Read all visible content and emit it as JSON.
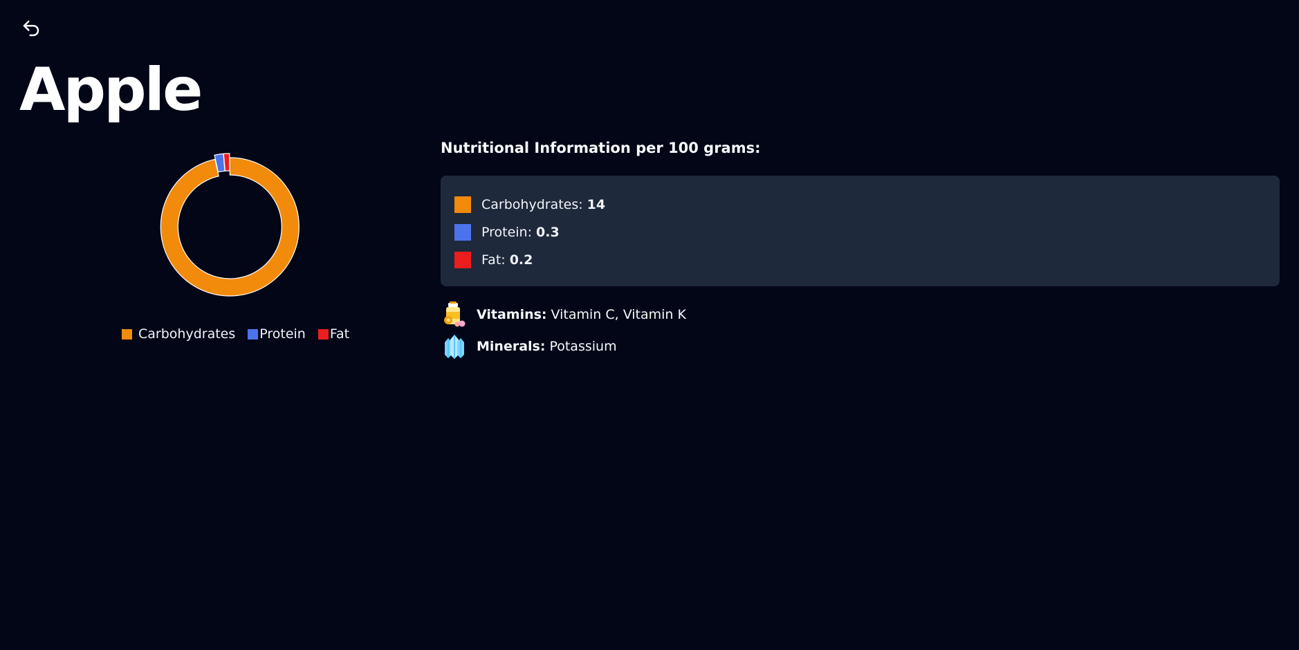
{
  "header": {
    "title": "Apple"
  },
  "icons": {
    "back": "undo-arrow-icon",
    "vitamins": "vitamin-bottle-icon",
    "minerals": "mineral-crystal-icon"
  },
  "colors": {
    "background": "#020617",
    "panel": "#1e293b",
    "carbohydrates": "#f28a0c",
    "protein": "#4b74ec",
    "fat": "#ee1d1d"
  },
  "chart_data": {
    "type": "doughnut",
    "categories": [
      "Carbohydrates",
      "Protein",
      "Fat"
    ],
    "values": [
      14,
      0.3,
      0.2
    ],
    "colors": [
      "#f28a0c",
      "#4b74ec",
      "#ee1d1d"
    ],
    "legend_position": "bottom"
  },
  "legend": {
    "items": [
      {
        "label": "Carbohydrates"
      },
      {
        "label": "Protein"
      },
      {
        "label": "Fat"
      }
    ]
  },
  "nutrition": {
    "title": "Nutritional Information per 100 grams:",
    "items": [
      {
        "label": "Carbohydrates:",
        "value": "14"
      },
      {
        "label": "Protein:",
        "value": "0.3"
      },
      {
        "label": "Fat:",
        "value": "0.2"
      }
    ]
  },
  "facts": {
    "vitamins": {
      "label": "Vitamins:",
      "value": "Vitamin C, Vitamin K"
    },
    "minerals": {
      "label": "Minerals:",
      "value": "Potassium"
    }
  }
}
